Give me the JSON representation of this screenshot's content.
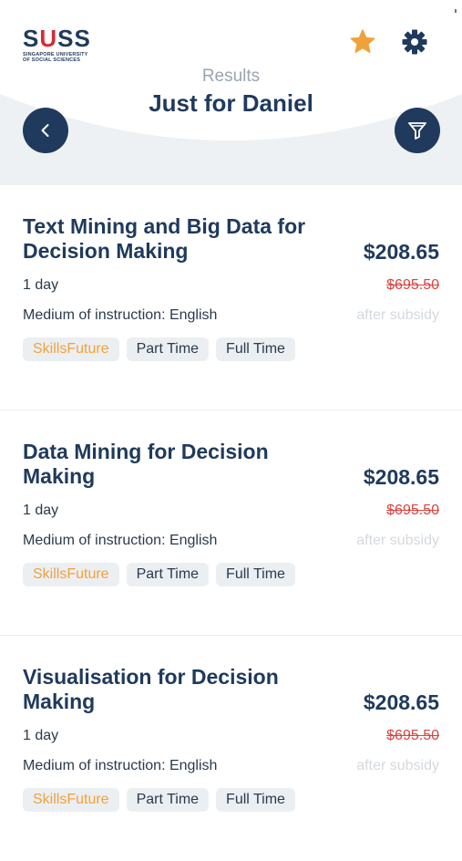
{
  "header": {
    "logo": {
      "wordmark_left": "S",
      "wordmark_u": "U",
      "wordmark_right": "SS",
      "tagline_line1": "SINGAPORE UNIVERSITY",
      "tagline_line2": "OF SOCIAL SCIENCES"
    },
    "subtitle": "Results",
    "title": "Just for Daniel",
    "icons": {
      "favorite": "star-icon",
      "settings": "gear-icon",
      "back": "chevron-left-icon",
      "filter": "funnel-icon"
    },
    "colors": {
      "navy": "#1f3a5c",
      "star": "#f0a23a",
      "band": "#eef1f3"
    }
  },
  "courses": [
    {
      "name": "Text Mining and Big Data for Decision Making",
      "price": "$208.65",
      "duration": "1 day",
      "original_price": "$695.50",
      "medium": "Medium of instruction: English",
      "subsidy_note": "after subsidy",
      "tags": [
        "SkillsFuture",
        "Part Time",
        "Full Time"
      ]
    },
    {
      "name": "Data Mining for Decision Making",
      "price": "$208.65",
      "duration": "1 day",
      "original_price": "$695.50",
      "medium": "Medium of instruction: English",
      "subsidy_note": "after subsidy",
      "tags": [
        "SkillsFuture",
        "Part Time",
        "Full Time"
      ]
    },
    {
      "name": "Visualisation for Decision Making",
      "price": "$208.65",
      "duration": "1 day",
      "original_price": "$695.50",
      "medium": "Medium of instruction: English",
      "subsidy_note": "after subsidy",
      "tags": [
        "SkillsFuture",
        "Part Time",
        "Full Time"
      ]
    }
  ]
}
